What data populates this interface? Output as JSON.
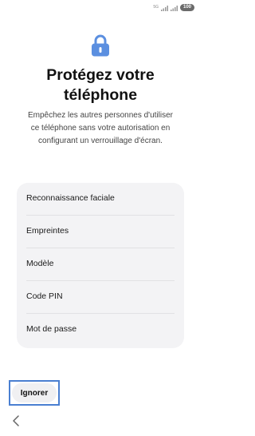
{
  "status_bar": {
    "network_label": "5G",
    "battery_level": "100"
  },
  "header": {
    "icon": "lock-icon",
    "title_line1": "Protégez votre",
    "title_line2": "téléphone",
    "description_line1": "Empêchez les autres personnes d'utiliser",
    "description_line2": "ce téléphone sans votre autorisation en",
    "description_line3": "configurant un verrouillage d'écran."
  },
  "options": [
    {
      "label": "Reconnaissance faciale"
    },
    {
      "label": "Empreintes"
    },
    {
      "label": "Modèle"
    },
    {
      "label": "Code PIN"
    },
    {
      "label": "Mot de passe"
    }
  ],
  "footer": {
    "skip_label": "Ignorer",
    "back_icon": "chevron-left-icon"
  },
  "colors": {
    "accent": "#4a7fd1",
    "lock_icon": "#5b8fe0",
    "card_background": "#f3f3f5"
  }
}
